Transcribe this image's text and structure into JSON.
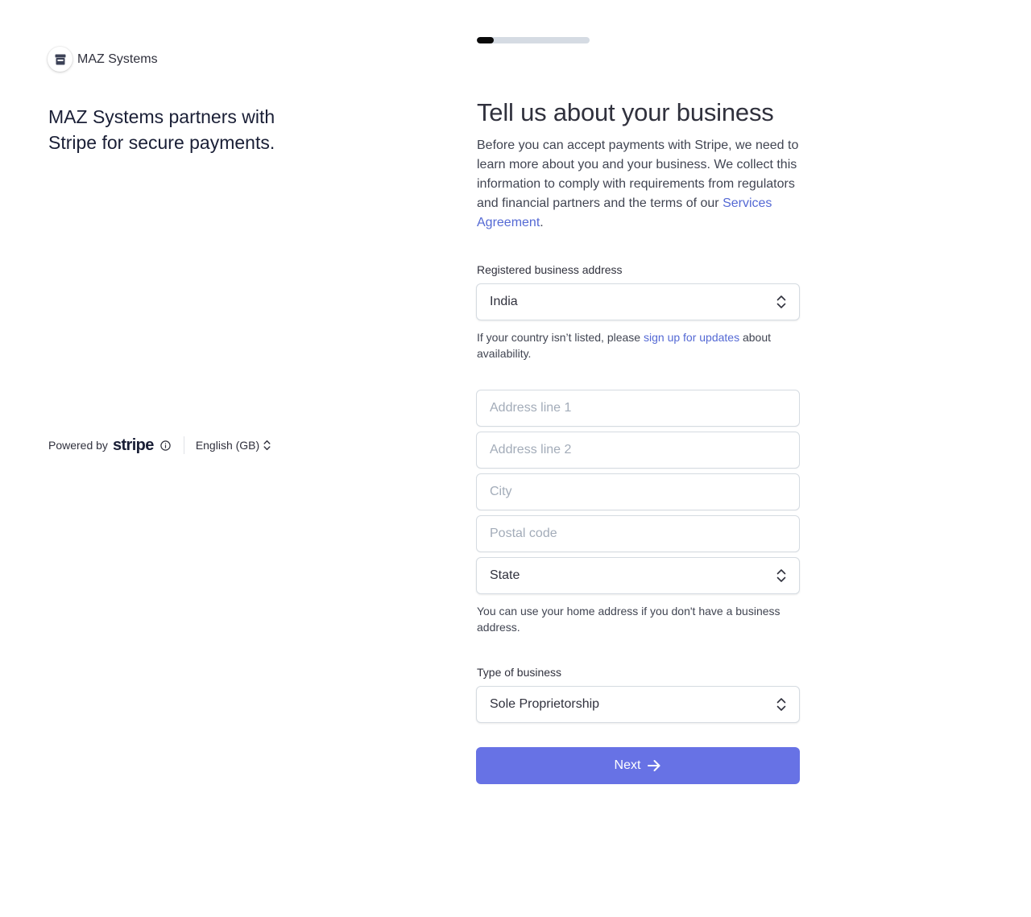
{
  "brand": {
    "name": "MAZ Systems",
    "tagline": "MAZ Systems partners with Stripe for secure payments."
  },
  "footer": {
    "powered_by": "Powered by",
    "stripe_wordmark": "stripe",
    "language": "English (GB)"
  },
  "progress": {
    "fraction": 0.15
  },
  "form": {
    "title": "Tell us about your business",
    "intro_text": "Before you can accept payments with Stripe, we need to learn more about you and your business. We collect this information to comply with requirements from regulators and financial partners and the terms of our ",
    "intro_link": "Services Agreement",
    "intro_end": ".",
    "address_label": "Registered business address",
    "country_value": "India",
    "country_help_before": "If your country isn’t listed, please ",
    "country_help_link": "sign up for updates",
    "country_help_after": " about availability.",
    "address_line1_placeholder": "Address line 1",
    "address_line2_placeholder": "Address line 2",
    "city_placeholder": "City",
    "postal_placeholder": "Postal code",
    "state_value": "State",
    "address_help": "You can use your home address if you don't have a business address.",
    "business_type_label": "Type of business",
    "business_type_value": "Sole Proprietorship",
    "next_label": "Next"
  },
  "colors": {
    "accent": "#6772e5",
    "link": "#5469d4",
    "progress_fill": "#0a0a0a",
    "progress_track": "#d5dbe3"
  },
  "icons": [
    "store-icon",
    "info-icon",
    "chevron-updown-icon",
    "arrow-right-icon"
  ]
}
